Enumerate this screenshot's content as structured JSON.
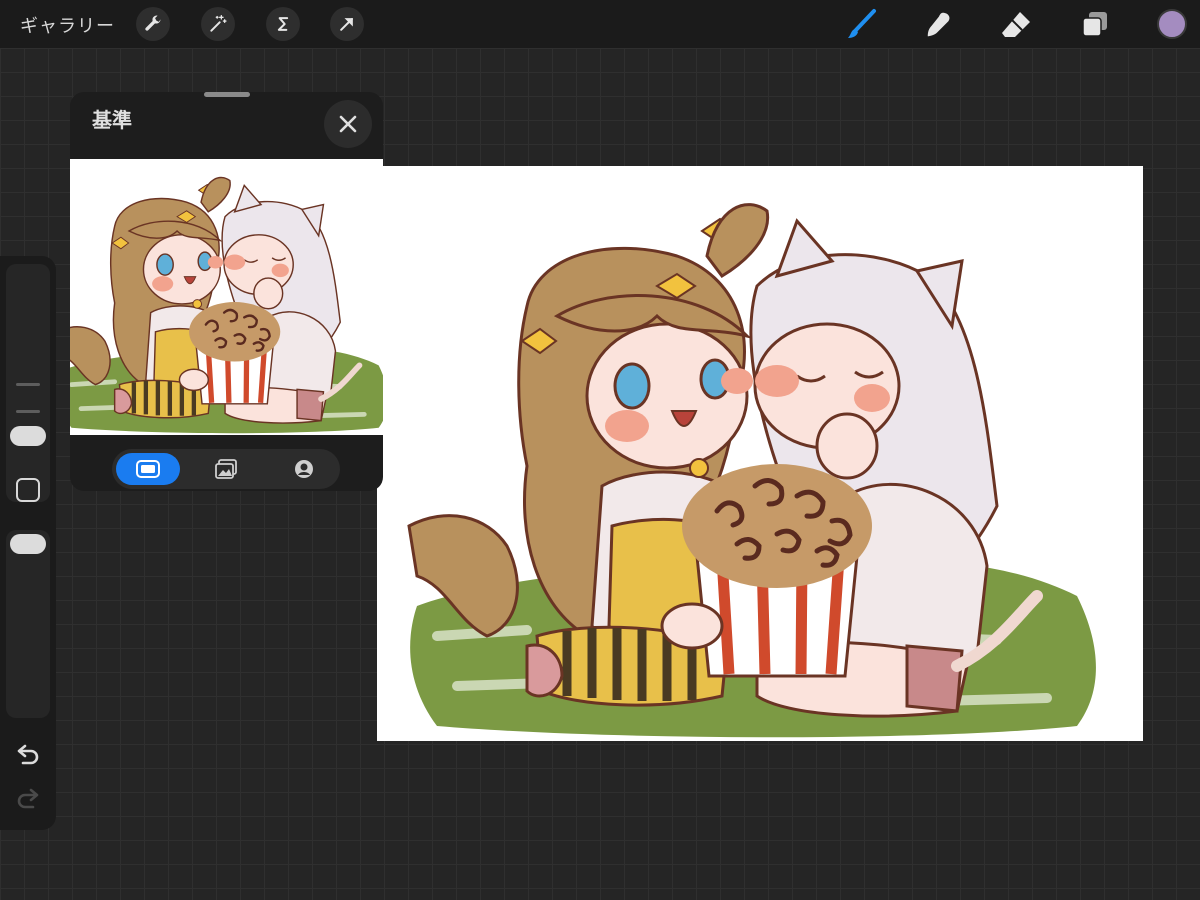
{
  "topbar": {
    "gallery_label": "ギャラリー",
    "left_tools": [
      "wrench-icon",
      "magic-wand-icon",
      "selection-icon",
      "transform-arrow-icon"
    ],
    "right_tools": [
      "brush-icon",
      "smudge-icon",
      "eraser-icon",
      "layers-icon"
    ],
    "brush_active_color": "#1f8ff0",
    "current_color": "#a48cc0"
  },
  "reference": {
    "title": "基準",
    "tabs": [
      "canvas-tab",
      "image-tab",
      "face-tab"
    ],
    "active_tab": 0
  },
  "sidebar": {
    "brush_size_slider": "brush-size",
    "opacity_slider": "opacity"
  },
  "colors": {
    "toolbar_bg": "#1b1b1b",
    "grass": "#7c9a44",
    "hair_brown": "#b8915d",
    "hair_white": "#ece6ec",
    "popcorn_red": "#d04a2c"
  }
}
